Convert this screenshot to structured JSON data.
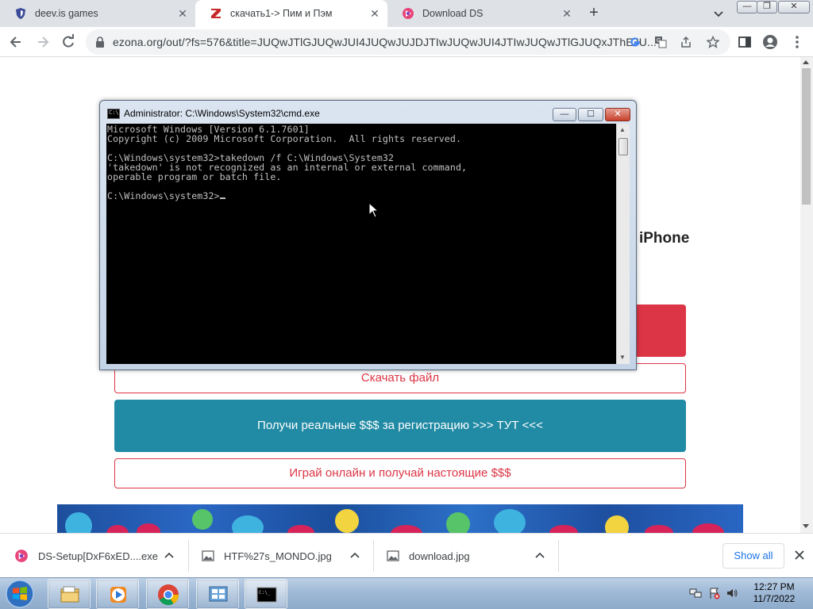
{
  "browser": {
    "tabs": [
      {
        "title": "deev.is games",
        "icon": "shield-icon",
        "active": false
      },
      {
        "title": "скачать1-> Пим и Пэм",
        "icon": "site-z-icon",
        "active": true
      },
      {
        "title": "Download DS",
        "icon": "ds-icon",
        "active": false
      }
    ],
    "url": "ezona.org/out/?fs=576&title=JUQwJTlGJUQwJUI4JUQwJUJDJTIwJUQwJUI4JTIwJUQwJTlGJUQxJThEJU..."
  },
  "page": {
    "heading_line1": "й iPhone",
    "heading_line2": ")",
    "download_file_label": "Скачать файл",
    "teal_button_label": "Получи реальные $$$ за регистрацию >>> ТУТ <<<",
    "play_button_label": "Играй онлайн и получай настоящие $$$",
    "colors": {
      "red": "#dc3545",
      "teal": "#218aa4"
    }
  },
  "cmd": {
    "title": "Administrator: C:\\Windows\\System32\\cmd.exe",
    "lines": [
      "Microsoft Windows [Version 6.1.7601]",
      "Copyright (c) 2009 Microsoft Corporation.  All rights reserved.",
      "",
      "C:\\Windows\\system32>takedown /f C:\\Windows\\System32",
      "'takedown' is not recognized as an internal or external command,",
      "operable program or batch file.",
      "",
      "C:\\Windows\\system32>"
    ]
  },
  "downloads": {
    "items": [
      {
        "name": "DS-Setup[DxF6xED....exe",
        "icon": "ds-icon"
      },
      {
        "name": "HTF%27s_MONDO.jpg",
        "icon": "image-file-icon"
      },
      {
        "name": "download.jpg",
        "icon": "image-file-icon"
      }
    ],
    "show_all_label": "Show all"
  },
  "taskbar": {
    "apps": [
      "explorer-icon",
      "media-player-icon",
      "chrome-icon",
      "control-panel-icon",
      "cmd-icon"
    ],
    "time": "12:27 PM",
    "date": "11/7/2022"
  }
}
